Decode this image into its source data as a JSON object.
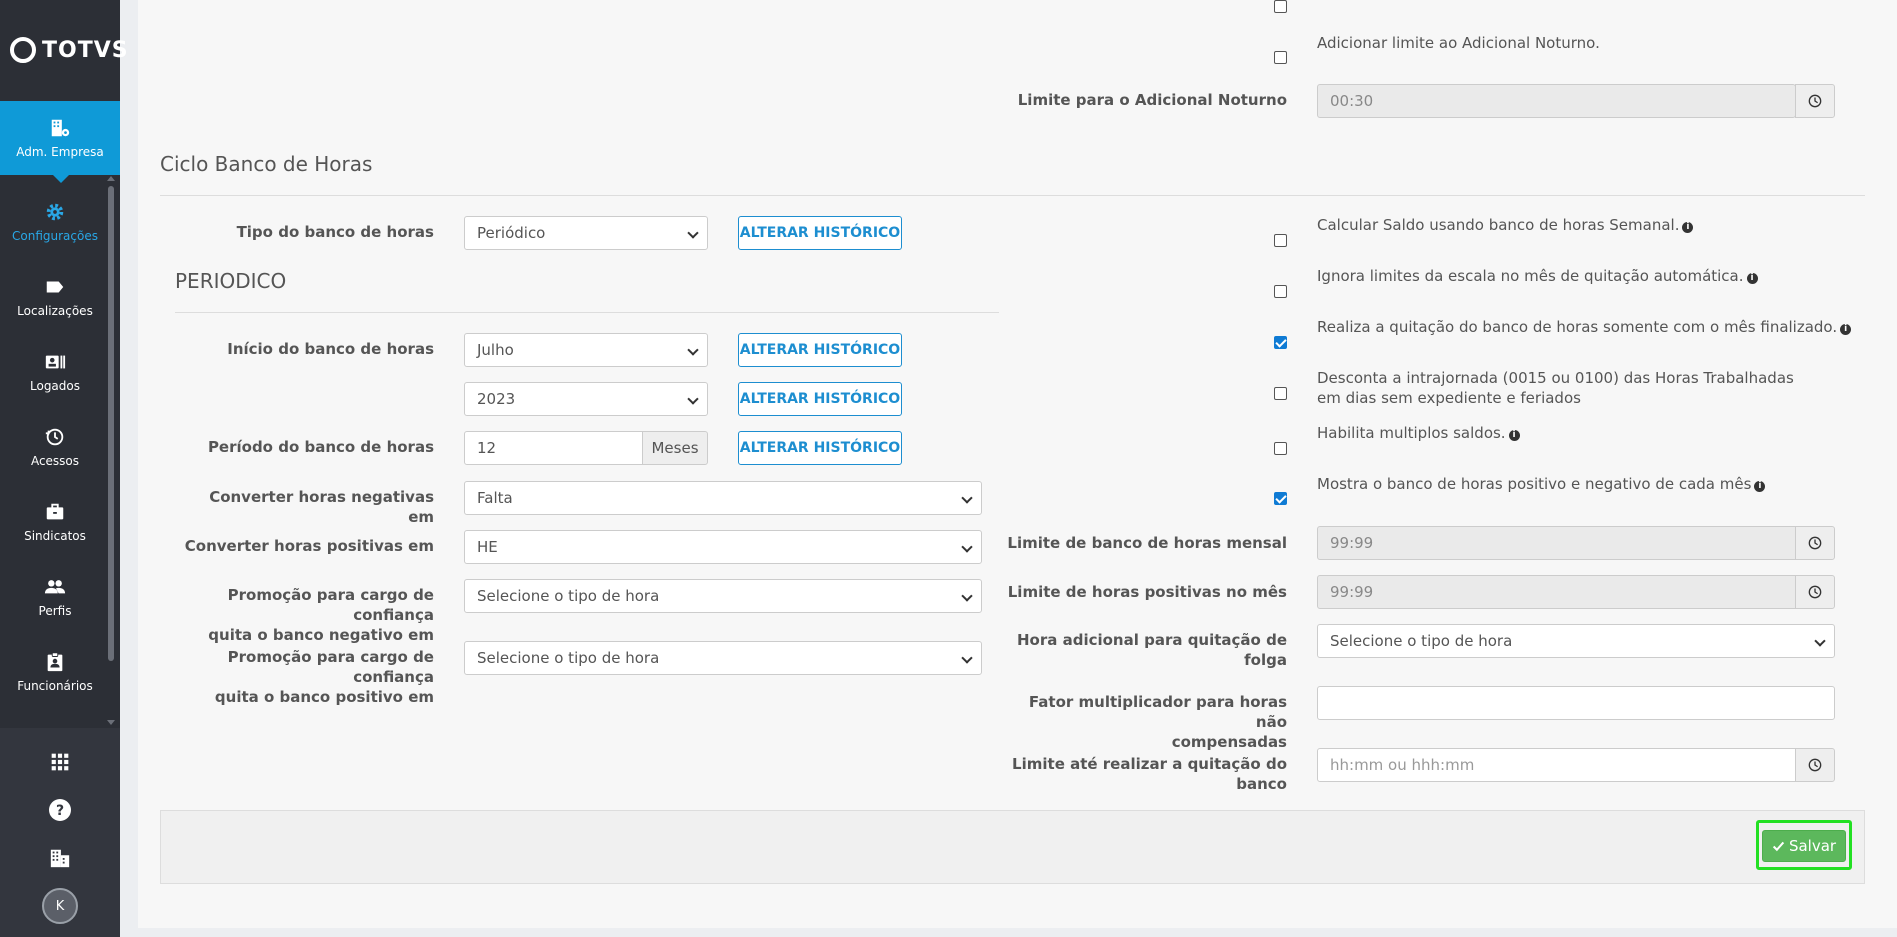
{
  "brand": {
    "logo_text": "TOTVS"
  },
  "sidebar": {
    "items": [
      {
        "label": "Adm. Empresa",
        "icon": "building-gear-icon"
      },
      {
        "label": "Configurações",
        "icon": "gear-icon"
      },
      {
        "label": "Localizações",
        "icon": "tag-icon"
      },
      {
        "label": "Logados",
        "icon": "id-card-icon"
      },
      {
        "label": "Acessos",
        "icon": "history-icon"
      },
      {
        "label": "Sindicatos",
        "icon": "briefcase-icon"
      },
      {
        "label": "Perfis",
        "icon": "users-icon"
      },
      {
        "label": "Funcionários",
        "icon": "clipboard-user-icon"
      }
    ],
    "avatar_initial": "K"
  },
  "top": {
    "noturno_limit_check_label": "Adicionar limite ao Adicional Noturno.",
    "noturno_limit_label": "Limite para o Adicional Noturno",
    "noturno_limit_value": "00:30"
  },
  "ciclo": {
    "title": "Ciclo Banco de Horas",
    "tipo_label": "Tipo do banco de horas",
    "tipo_value": "Periódico",
    "alterar_label": "ALTERAR HISTÓRICO",
    "periodico_title": "PERIODICO",
    "inicio_label": "Início do banco de horas",
    "inicio_mes": "Julho",
    "inicio_ano": "2023",
    "periodo_label": "Período do banco de horas",
    "periodo_value": "12",
    "periodo_unit": "Meses",
    "neg_label": "Converter horas negativas em",
    "neg_value": "Falta",
    "pos_label": "Converter horas positivas em",
    "pos_value": "HE",
    "promo_neg_label_1": "Promoção para cargo de confiança",
    "promo_neg_label_2": "quita o banco negativo em",
    "promo_neg_value": "Selecione o tipo de hora",
    "promo_pos_label_1": "Promoção para cargo de confiança",
    "promo_pos_label_2": "quita o banco positivo em",
    "promo_pos_value": "Selecione o tipo de hora"
  },
  "options": [
    {
      "label": "Calcular Saldo usando banco de horas Semanal.",
      "checked": false,
      "info": true
    },
    {
      "label": "Ignora limites da escala no mês de quitação automática.",
      "checked": false,
      "info": true
    },
    {
      "label": "Realiza a quitação do banco de horas somente com o mês finalizado.",
      "checked": true,
      "info": true
    },
    {
      "label": "Desconta a intrajornada (0015 ou 0100) das Horas Trabalhadas em dias sem expediente e feriados",
      "checked": false,
      "info": false
    },
    {
      "label": "Habilita multiplos saldos.",
      "checked": false,
      "info": true
    },
    {
      "label": "Mostra o banco de horas positivo e negativo de cada mês",
      "checked": true,
      "info": true
    }
  ],
  "limits": {
    "mensal_label": "Limite de banco de horas mensal",
    "mensal_value": "99:99",
    "positivas_label": "Limite de horas positivas no mês",
    "positivas_value": "99:99",
    "folga_label_1": "Hora adicional para quitação de",
    "folga_label_2": "folga",
    "folga_value": "Selecione o tipo de hora",
    "fator_label_1": "Fator multiplicador para horas não",
    "fator_label_2": "compensadas",
    "fator_value": "",
    "quitacao_label_1": "Limite até realizar a quitação do",
    "quitacao_label_2": "banco",
    "quitacao_placeholder": "hh:mm ou hhh:mm"
  },
  "footer": {
    "save_label": "Salvar"
  }
}
